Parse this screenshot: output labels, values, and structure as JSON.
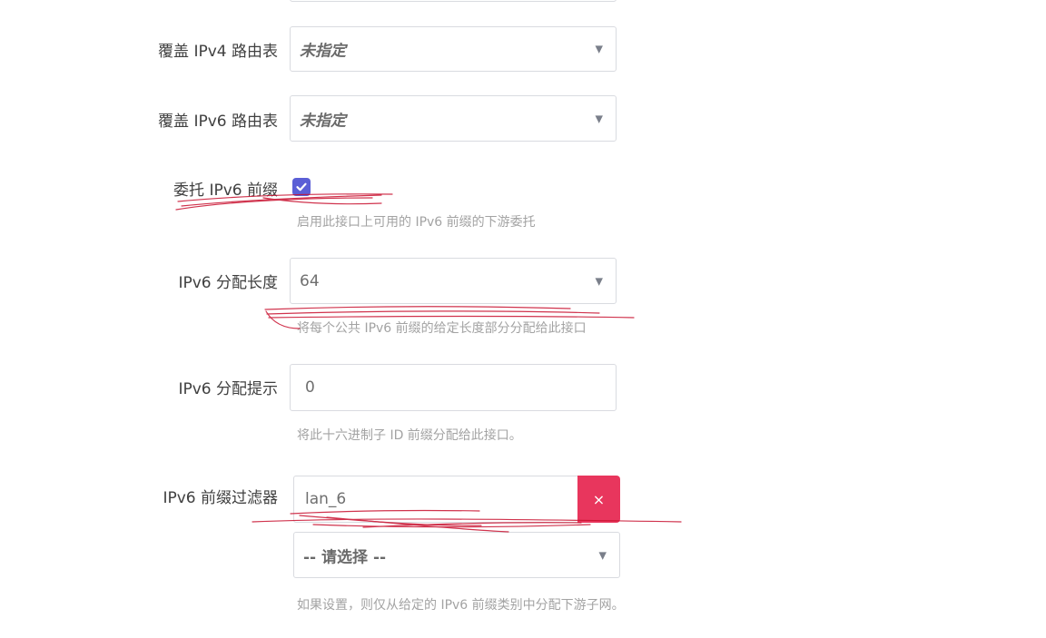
{
  "fields": {
    "ipv4_table": {
      "label": "覆盖 IPv4 路由表",
      "value": "未指定"
    },
    "ipv6_table": {
      "label": "覆盖 IPv6 路由表",
      "value": "未指定"
    },
    "delegate": {
      "label": "委托 IPv6 前缀",
      "checked": true,
      "hint": "启用此接口上可用的 IPv6 前缀的下游委托"
    },
    "assign_length": {
      "label": "IPv6 分配长度",
      "value": "64",
      "hint": "将每个公共 IPv6 前缀的给定长度部分分配给此接口"
    },
    "assign_hint": {
      "label": "IPv6 分配提示",
      "value": "0",
      "hint": "将此十六进制子 ID 前缀分配给此接口。"
    },
    "prefix_filter": {
      "label": "IPv6 前缀过滤器",
      "value": "lan_6",
      "remove_symbol": "×",
      "select_placeholder": "-- 请选择 --",
      "hint": "如果设置，则仅从给定的 IPv6 前缀类别中分配下游子网。"
    }
  },
  "icons": {
    "caret": "triangle-down-icon",
    "check": "checkmark-icon",
    "remove": "close-icon"
  },
  "colors": {
    "checkbox": "#5b5fd6",
    "remove_button": "#e8365d",
    "annotation": "#c8102e"
  }
}
